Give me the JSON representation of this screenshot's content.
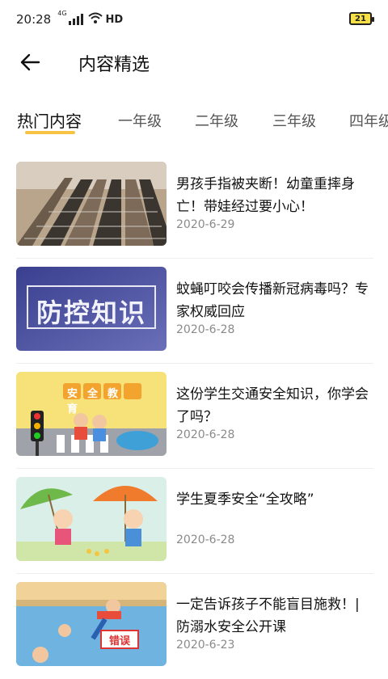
{
  "status": {
    "time": "20:28",
    "network": "4G",
    "hd": "HD",
    "battery": "21"
  },
  "header": {
    "title": "内容精选"
  },
  "tabs": [
    {
      "label": "热门内容",
      "active": true
    },
    {
      "label": "一年级",
      "active": false
    },
    {
      "label": "二年级",
      "active": false
    },
    {
      "label": "三年级",
      "active": false
    },
    {
      "label": "四年级",
      "active": false
    }
  ],
  "colors": {
    "accent": "#f6c344"
  },
  "articles": [
    {
      "title": "男孩手指被夹断！幼童重摔身亡！带娃经过要小心！",
      "date": "2020-6-29",
      "thumb_text": ""
    },
    {
      "title": "蚊蝇叮咬会传播新冠病毒吗？专家权威回应",
      "date": "2020-6-28",
      "thumb_text": "防控知识"
    },
    {
      "title": "这份学生交通安全知识，你学会了吗？",
      "date": "2020-6-28",
      "thumb_text": "安全教育"
    },
    {
      "title": "学生夏季安全“全攻略”",
      "date": "2020-6-28",
      "thumb_text": ""
    },
    {
      "title": "一定告诉孩子不能盲目施救！| 防溺水安全公开课",
      "date": "2020-6-23",
      "thumb_text": "错误"
    }
  ]
}
